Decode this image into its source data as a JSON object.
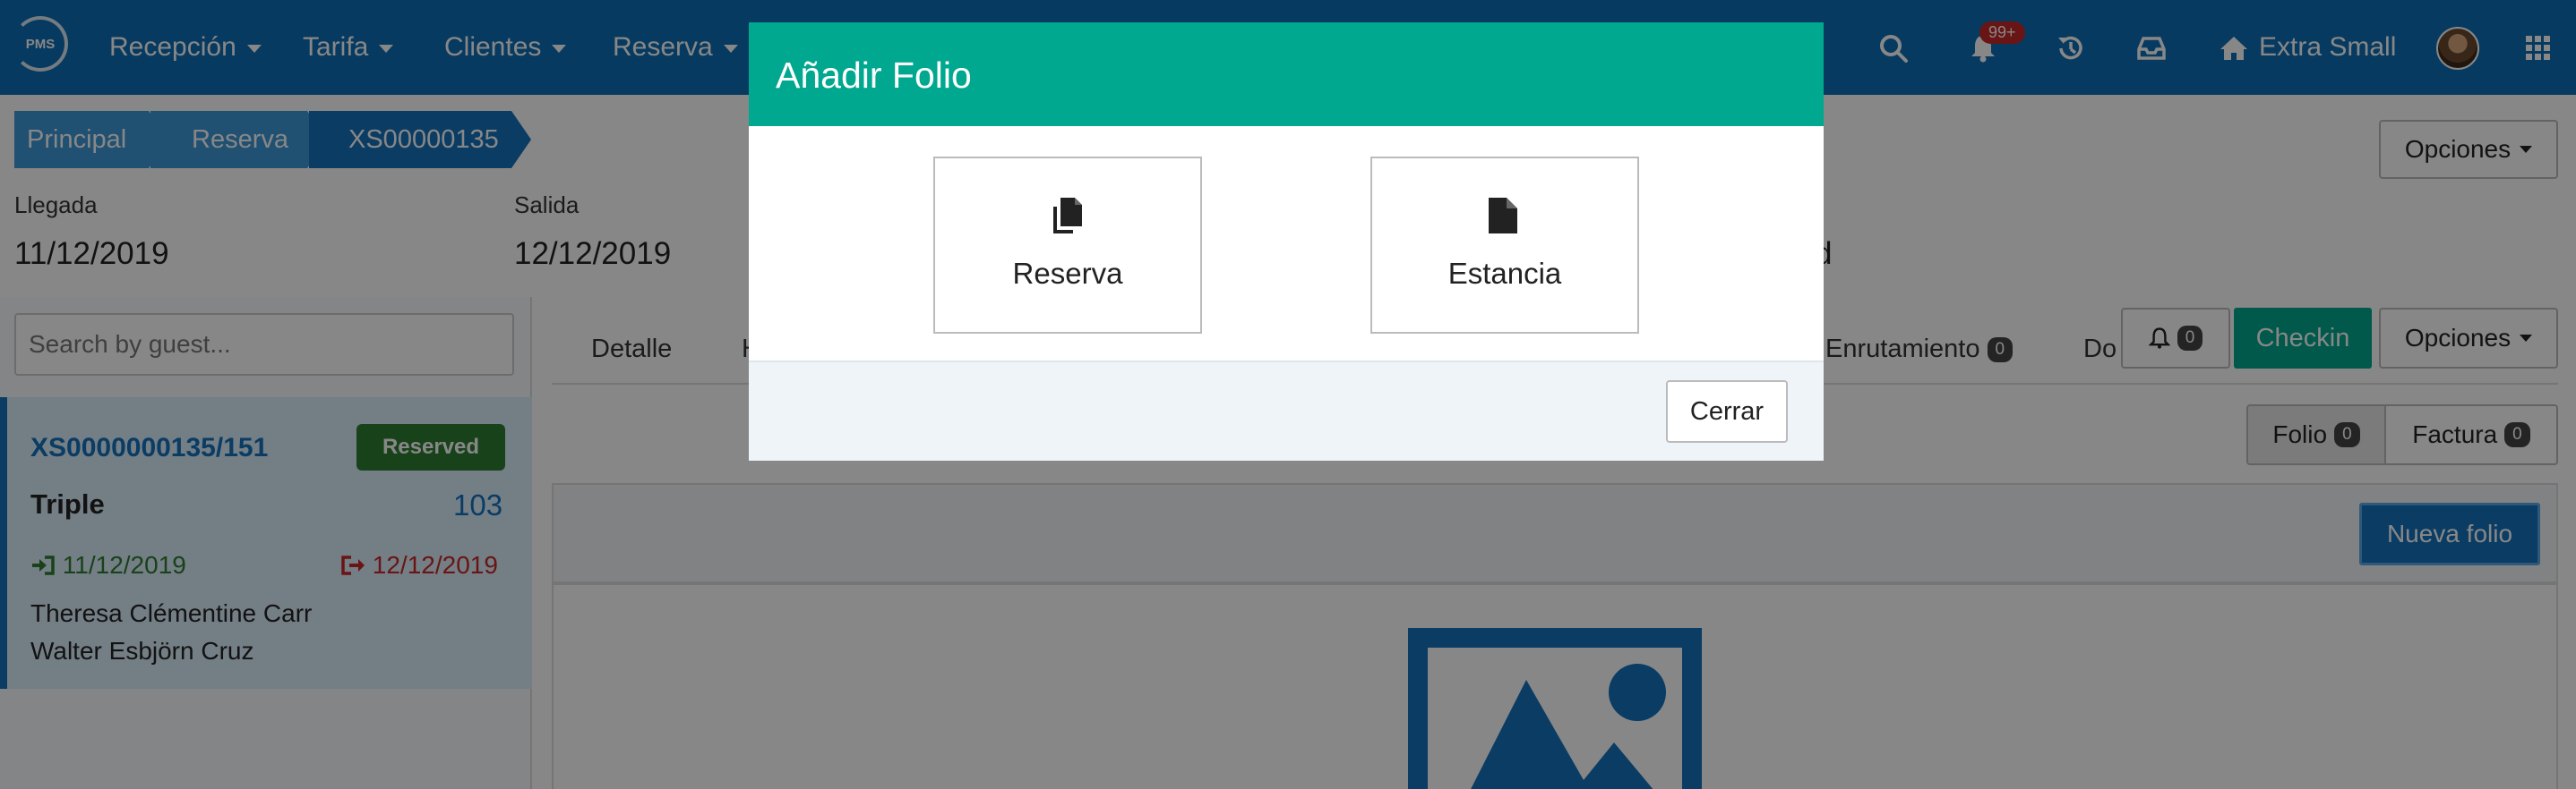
{
  "nav": {
    "logo_text": "PMS",
    "items": [
      {
        "label": "Recepción"
      },
      {
        "label": "Tarifa"
      },
      {
        "label": "Clientes"
      },
      {
        "label": "Reserva"
      }
    ],
    "notification_badge": "99+",
    "property_name": "Extra Small",
    "icons": [
      "search-icon",
      "bell-icon",
      "history-icon",
      "inbox-icon",
      "home-icon",
      "grid-icon"
    ]
  },
  "breadcrumb": [
    "Principal",
    "Reserva",
    "XS00000135"
  ],
  "header": {
    "options_label": "Opciones",
    "llegada_label": "Llegada",
    "llegada_value": "11/12/2019",
    "salida_label": "Salida",
    "salida_value": "12/12/2019",
    "partial_value": "d"
  },
  "sidebar": {
    "search_placeholder": "Search by guest...",
    "reservation": {
      "id": "XS0000000135/151",
      "status": "Reserved",
      "room_type": "Triple",
      "room_number": "103",
      "arrival": "11/12/2019",
      "departure": "12/12/2019",
      "guests": [
        "Theresa Clémentine Carr",
        "Walter Esbjörn Cruz"
      ]
    }
  },
  "main": {
    "tabs": {
      "detalle": "Detalle",
      "h_partial": "H",
      "enrutamiento": "Enrutamiento",
      "enrutamiento_count": "0",
      "do_partial": "Do"
    },
    "bell_count": "0",
    "checkin_label": "Checkin",
    "options_label": "Opciones",
    "folio_label": "Folio",
    "folio_count": "0",
    "factura_label": "Factura",
    "factura_count": "0",
    "nueva_folio_label": "Nueva folio"
  },
  "modal": {
    "title": "Añadir Folio",
    "choices": [
      {
        "label": "Reserva",
        "icon": "copy-icon"
      },
      {
        "label": "Estancia",
        "icon": "file-icon"
      }
    ],
    "close_label": "Cerrar"
  },
  "colors": {
    "nav_bg": "#0f6fb5",
    "modal_header": "#00a88f",
    "reserved_badge": "#2e7d32",
    "arrival": "#2e7d32",
    "departure": "#c62828"
  }
}
